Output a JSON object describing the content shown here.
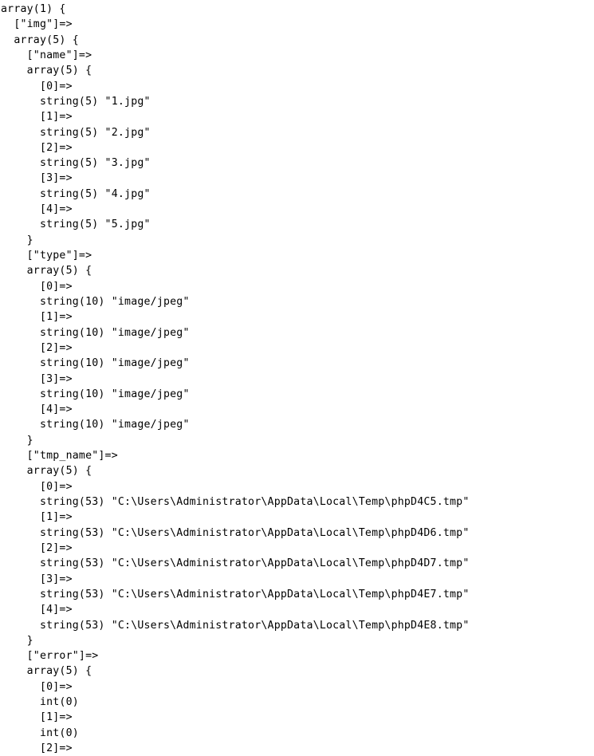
{
  "page": {
    "kind": "php-var-dump-text-output",
    "background_color": "#ffffff",
    "text_color": "#000000",
    "total_lines_rendered": 48,
    "last_line_clipped": true
  },
  "dump": {
    "root_type": "array",
    "root_count": 1,
    "lines": [
      "array(1) {",
      "  [\"img\"]=>",
      "  array(5) {",
      "    [\"name\"]=>",
      "    array(5) {",
      "      [0]=>",
      "      string(5) \"1.jpg\"",
      "      [1]=>",
      "      string(5) \"2.jpg\"",
      "      [2]=>",
      "      string(5) \"3.jpg\"",
      "      [3]=>",
      "      string(5) \"4.jpg\"",
      "      [4]=>",
      "      string(5) \"5.jpg\"",
      "    }",
      "    [\"type\"]=>",
      "    array(5) {",
      "      [0]=>",
      "      string(10) \"image/jpeg\"",
      "      [1]=>",
      "      string(10) \"image/jpeg\"",
      "      [2]=>",
      "      string(10) \"image/jpeg\"",
      "      [3]=>",
      "      string(10) \"image/jpeg\"",
      "      [4]=>",
      "      string(10) \"image/jpeg\"",
      "    }",
      "    [\"tmp_name\"]=>",
      "    array(5) {",
      "      [0]=>",
      "      string(53) \"C:\\Users\\Administrator\\AppData\\Local\\Temp\\phpD4C5.tmp\"",
      "      [1]=>",
      "      string(53) \"C:\\Users\\Administrator\\AppData\\Local\\Temp\\phpD4D6.tmp\"",
      "      [2]=>",
      "      string(53) \"C:\\Users\\Administrator\\AppData\\Local\\Temp\\phpD4D7.tmp\"",
      "      [3]=>",
      "      string(53) \"C:\\Users\\Administrator\\AppData\\Local\\Temp\\phpD4E7.tmp\"",
      "      [4]=>",
      "      string(53) \"C:\\Users\\Administrator\\AppData\\Local\\Temp\\phpD4E8.tmp\"",
      "    }",
      "    [\"error\"]=>",
      "    array(5) {",
      "      [0]=>",
      "      int(0)",
      "      [1]=>",
      "      int(0)",
      "      [2]=>"
    ],
    "keys": {
      "img": "img",
      "name": "name",
      "type": "type",
      "tmp_name": "tmp_name",
      "error": "error"
    },
    "values": {
      "name": [
        "1.jpg",
        "2.jpg",
        "3.jpg",
        "4.jpg",
        "5.jpg"
      ],
      "type": [
        "image/jpeg",
        "image/jpeg",
        "image/jpeg",
        "image/jpeg",
        "image/jpeg"
      ],
      "tmp_name": [
        "C:\\Users\\Administrator\\AppData\\Local\\Temp\\phpD4C5.tmp",
        "C:\\Users\\Administrator\\AppData\\Local\\Temp\\phpD4D6.tmp",
        "C:\\Users\\Administrator\\AppData\\Local\\Temp\\phpD4D7.tmp",
        "C:\\Users\\Administrator\\AppData\\Local\\Temp\\phpD4E7.tmp",
        "C:\\Users\\Administrator\\AppData\\Local\\Temp\\phpD4E8.tmp"
      ],
      "error": [
        0,
        0
      ]
    },
    "string_lengths": {
      "name": 5,
      "type": 10,
      "tmp_name": 53
    }
  }
}
